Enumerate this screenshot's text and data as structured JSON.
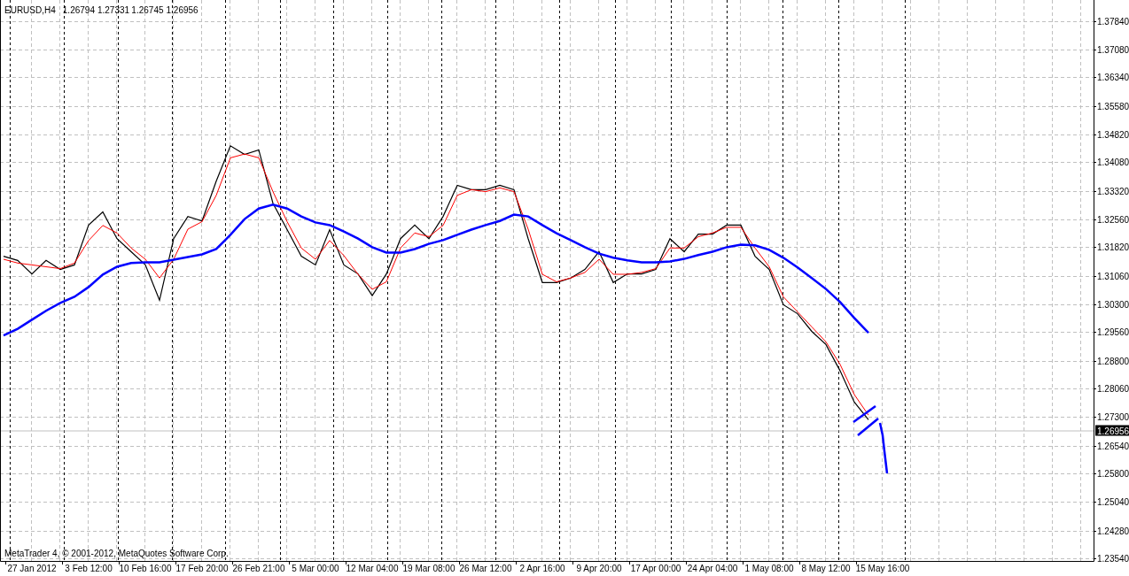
{
  "header": {
    "symbol": "EURUSD,H4",
    "quotes": [
      "1.26794",
      "1.27331",
      "1.26745",
      "1.26956"
    ]
  },
  "copyright": "MetaTrader 4, © 2001-2012, MetaQuotes Software Corp.",
  "current_price": "1.26956",
  "chart_data": {
    "type": "line",
    "grid": true,
    "categories": [
      null,
      null,
      "27 Jan 2012",
      null,
      null,
      null,
      "3 Feb 12:00",
      null,
      null,
      null,
      "10 Feb 16:00",
      null,
      null,
      null,
      "17 Feb 20:00",
      null,
      null,
      null,
      "26 Feb 21:00",
      null,
      null,
      null,
      "5 Mar 00:00",
      null,
      null,
      null,
      "12 Mar 04:00",
      null,
      null,
      null,
      "19 Mar 08:00",
      null,
      null,
      null,
      "26 Mar 12:00",
      null,
      null,
      null,
      "2 Apr 16:00",
      null,
      null,
      null,
      "9 Apr 20:00",
      null,
      null,
      null,
      "17 Apr 00:00",
      null,
      null,
      null,
      "24 Apr 04:00",
      null,
      null,
      null,
      "1 May 08:00",
      null,
      null,
      null,
      "8 May 12:00",
      null,
      null,
      null,
      "15 May 16:00"
    ],
    "series": [
      {
        "color": "#000000",
        "values": [
          1.3158,
          1.3147,
          1.3111,
          1.3147,
          1.3123,
          1.3135,
          1.3241,
          1.3276,
          1.3205,
          1.317,
          1.3135,
          1.3041,
          1.3205,
          1.3264,
          1.3252,
          1.3358,
          1.3452,
          1.3429,
          1.3441,
          1.3299,
          1.3229,
          1.3158,
          1.3135,
          1.3229,
          1.3135,
          1.3111,
          1.3053,
          1.3111,
          1.3205,
          1.3241,
          1.3205,
          1.3264,
          1.3347,
          1.3335,
          1.3335,
          1.3347,
          1.3335,
          1.3205,
          1.3088,
          1.3088,
          1.31,
          1.3123,
          1.317,
          1.3088,
          1.3111,
          1.3111,
          1.3123,
          1.3205,
          1.317,
          1.3217,
          1.3217,
          1.3241,
          1.3241,
          1.3158,
          1.3123,
          1.3029,
          1.3005,
          1.2958,
          1.2923,
          1.2853,
          1.277,
          1.2723,
          null
        ]
      },
      {
        "color": "#ff0000",
        "values": [
          1.315,
          1.314,
          1.3135,
          1.313,
          1.3125,
          1.314,
          1.32,
          1.324,
          1.322,
          1.318,
          1.315,
          1.31,
          1.315,
          1.323,
          1.325,
          1.332,
          1.342,
          1.343,
          1.342,
          1.333,
          1.325,
          1.318,
          1.315,
          1.32,
          1.316,
          1.311,
          1.307,
          1.309,
          1.318,
          1.322,
          1.321,
          1.324,
          1.332,
          1.3335,
          1.333,
          1.334,
          1.333,
          1.323,
          1.311,
          1.309,
          1.31,
          1.3115,
          1.315,
          1.311,
          1.311,
          1.3115,
          1.3125,
          1.318,
          1.318,
          1.321,
          1.322,
          1.3235,
          1.3235,
          1.318,
          1.313,
          1.305,
          1.301,
          1.297,
          1.293,
          1.287,
          1.279,
          1.2735,
          null
        ]
      },
      {
        "color": "#0000ff",
        "values": [
          1.2947,
          1.2965,
          1.2989,
          1.3013,
          1.3034,
          1.305,
          1.3076,
          1.3109,
          1.313,
          1.314,
          1.3142,
          1.3142,
          1.3149,
          1.3156,
          1.3163,
          1.3177,
          1.3215,
          1.3257,
          1.3285,
          1.3295,
          1.3285,
          1.3264,
          1.3248,
          1.3241,
          1.3224,
          1.3205,
          1.3182,
          1.3168,
          1.3168,
          1.3177,
          1.3191,
          1.3201,
          1.3215,
          1.3229,
          1.3241,
          1.3252,
          1.3269,
          1.3264,
          1.3241,
          1.3219,
          1.3201,
          1.3182,
          1.3165,
          1.3154,
          1.3147,
          1.3142,
          1.3142,
          1.3144,
          1.3151,
          1.3161,
          1.317,
          1.3182,
          1.3189,
          1.3187,
          1.3175,
          1.3154,
          1.3128,
          1.31,
          1.3071,
          1.3036,
          1.2994,
          1.2954,
          null
        ]
      }
    ],
    "ylim": [
      1.2347,
      1.384
    ],
    "yticks": [
      {
        "value": 1.3784,
        "label": "1.37840"
      },
      {
        "value": 1.3708,
        "label": "1.37080"
      },
      {
        "value": 1.3634,
        "label": "1.36340"
      },
      {
        "value": 1.3558,
        "label": "1.35580"
      },
      {
        "value": 1.3482,
        "label": "1.34820"
      },
      {
        "value": 1.3408,
        "label": "1.34080"
      },
      {
        "value": 1.3332,
        "label": "1.33320"
      },
      {
        "value": 1.3256,
        "label": "1.32560"
      },
      {
        "value": 1.3182,
        "label": "1.31820"
      },
      {
        "value": 1.3106,
        "label": "1.31060"
      },
      {
        "value": 1.303,
        "label": "1.30300"
      },
      {
        "value": 1.2956,
        "label": "1.29560"
      },
      {
        "value": 1.288,
        "label": "1.28800"
      },
      {
        "value": 1.2806,
        "label": "1.28060"
      },
      {
        "value": 1.273,
        "label": "1.27300"
      },
      {
        "value": 1.2654,
        "label": "1.26540"
      },
      {
        "value": 1.258,
        "label": "1.25800"
      },
      {
        "value": 1.2504,
        "label": "1.25040"
      },
      {
        "value": 1.2428,
        "label": "1.24280"
      },
      {
        "value": 1.2354,
        "label": "1.23540"
      }
    ]
  }
}
